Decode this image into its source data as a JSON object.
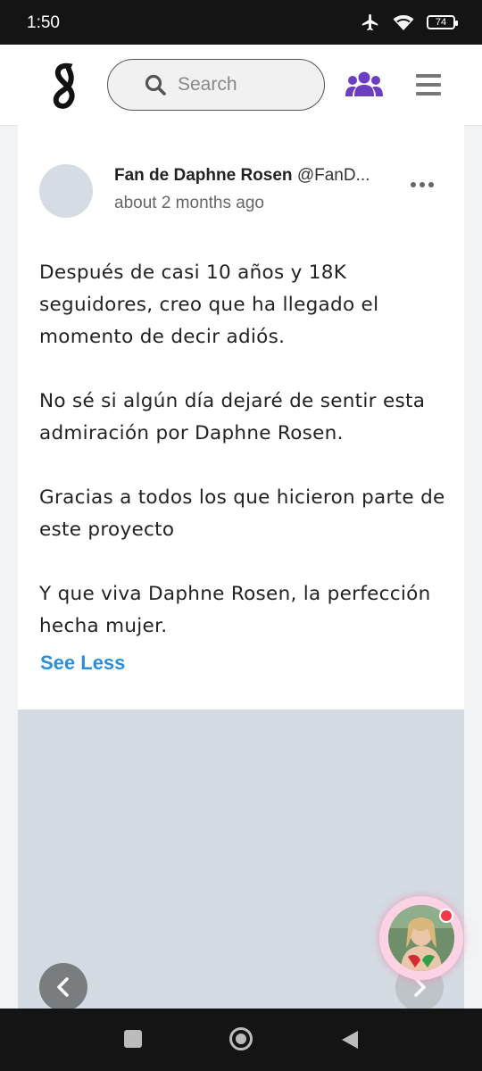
{
  "status_bar": {
    "time": "1:50",
    "battery": "74",
    "icons": [
      "airplane-mode-icon",
      "wifi-icon",
      "battery-icon"
    ]
  },
  "header": {
    "logo": "S",
    "search": {
      "placeholder": "Search",
      "value": ""
    },
    "icons": [
      "search-icon",
      "groups-icon",
      "menu-icon"
    ],
    "accent_color": "#6c3fc1"
  },
  "post": {
    "author_name": "Fan de Daphne Rosen",
    "author_handle": "@FanD...",
    "timestamp": "about 2 months ago",
    "paragraphs": [
      "Después de casi 10 años y 18K seguidores, creo que ha llegado el momento de decir adiós.",
      "No sé si algún día dejaré de sentir esta admiración por Daphne Rosen.",
      "Gracias a todos los que hicieron parte de este proyecto",
      "Y que viva Daphne Rosen, la perfección hecha mujer."
    ],
    "see_less": "See Less",
    "link_color": "#2b8fd8"
  },
  "media": {
    "prev_icon": "chevron-left-icon",
    "next_icon": "chevron-right-icon"
  },
  "android_nav": [
    "recents-icon",
    "home-icon",
    "back-icon"
  ]
}
